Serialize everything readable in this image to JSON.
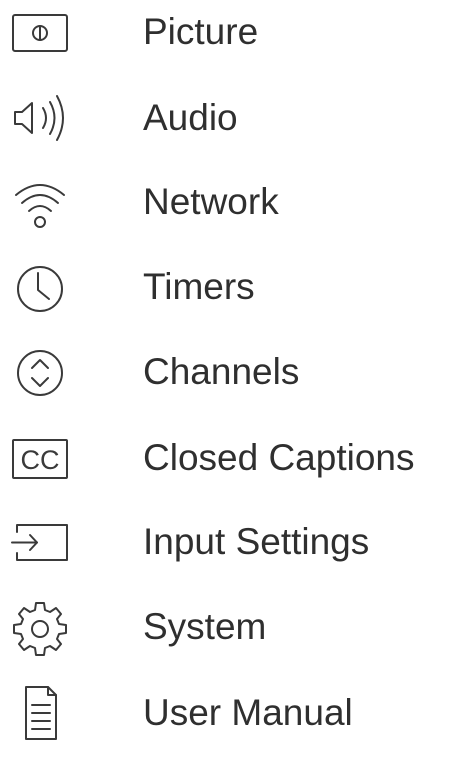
{
  "menu": {
    "items": [
      {
        "label": "Picture",
        "icon": "picture-icon"
      },
      {
        "label": "Audio",
        "icon": "speaker-icon"
      },
      {
        "label": "Network",
        "icon": "wifi-icon"
      },
      {
        "label": "Timers",
        "icon": "clock-icon"
      },
      {
        "label": "Channels",
        "icon": "channel-up-down-icon"
      },
      {
        "label": "Closed Captions",
        "icon": "closed-captions-icon",
        "icon_text": "CC"
      },
      {
        "label": "Input Settings",
        "icon": "input-icon"
      },
      {
        "label": "System",
        "icon": "gear-icon"
      },
      {
        "label": "User Manual",
        "icon": "document-icon"
      }
    ]
  }
}
